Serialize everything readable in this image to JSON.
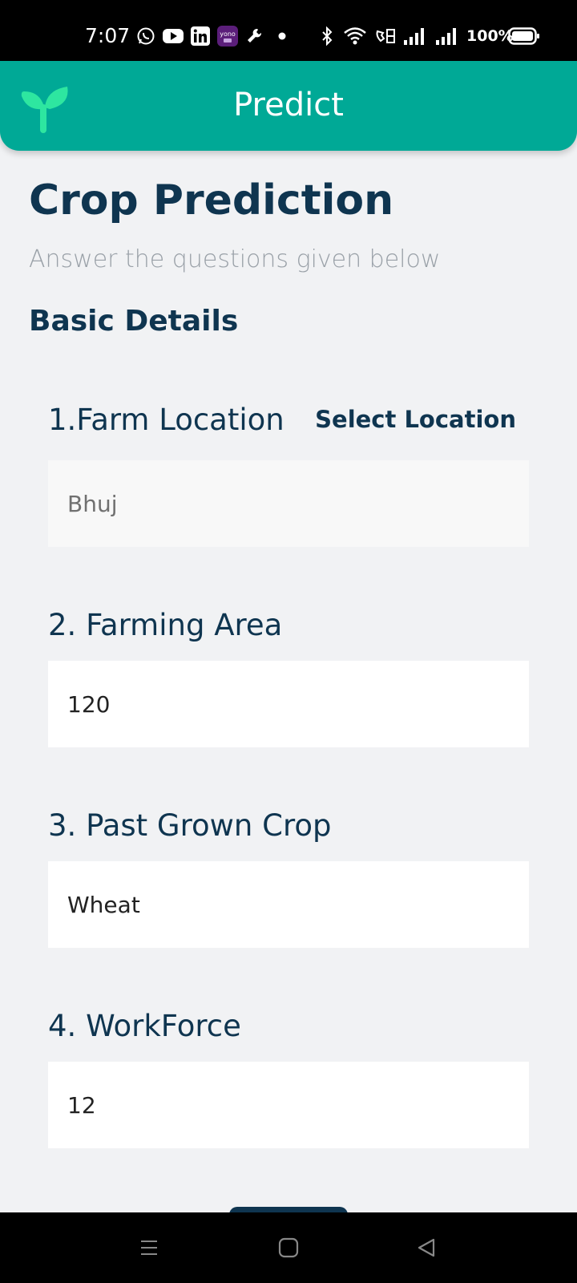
{
  "status_bar": {
    "time": "7:07",
    "battery": "100%",
    "icons": [
      "whatsapp-icon",
      "youtube-icon",
      "linkedin-icon",
      "yono-sbi-icon",
      "wrench-icon",
      "dot-icon",
      "bluetooth-icon",
      "wifi-icon",
      "volte-icon",
      "signal-icon",
      "signal-icon",
      "battery-icon"
    ],
    "yono_label": "yono"
  },
  "app_bar": {
    "title": "Predict",
    "logo": "sprout-icon",
    "color": "#00a996"
  },
  "page": {
    "title": "Crop Prediction",
    "subtitle": "Answer the questions given below",
    "section": "Basic Details"
  },
  "questions": [
    {
      "label": "1.Farm Location",
      "value": "Bhuj",
      "action": "Select Location"
    },
    {
      "label": "2. Farming Area",
      "value": "120"
    },
    {
      "label": "3. Past Grown Crop",
      "value": "Wheat"
    },
    {
      "label": "4. WorkForce",
      "value": "12"
    }
  ],
  "nav_bar": {
    "icons": [
      "recent-apps-icon",
      "home-icon",
      "back-icon"
    ]
  },
  "colors": {
    "primary_dark": "#0f3550",
    "accent": "#00a996",
    "background": "#f1f2f4"
  }
}
